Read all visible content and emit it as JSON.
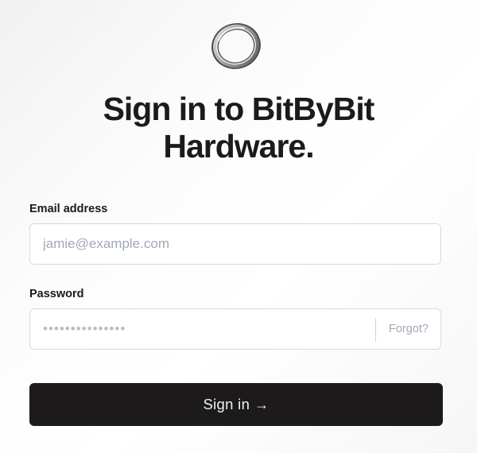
{
  "brand": {
    "logo_icon": "ring-logo-icon"
  },
  "heading": {
    "line1": "Sign in to BitByBit",
    "line2": "Hardware."
  },
  "email": {
    "label": "Email address",
    "placeholder": "jamie@example.com",
    "value": ""
  },
  "password": {
    "label": "Password",
    "placeholder": "•••••••••••••••",
    "forgot_label": "Forgot?"
  },
  "submit": {
    "label": "Sign in",
    "icon": "arrow-right-icon",
    "arrow_glyph": "→"
  },
  "colors": {
    "primary": "#1c1a1b",
    "placeholder": "#a2a9b8",
    "border": "#d9d9dc"
  }
}
